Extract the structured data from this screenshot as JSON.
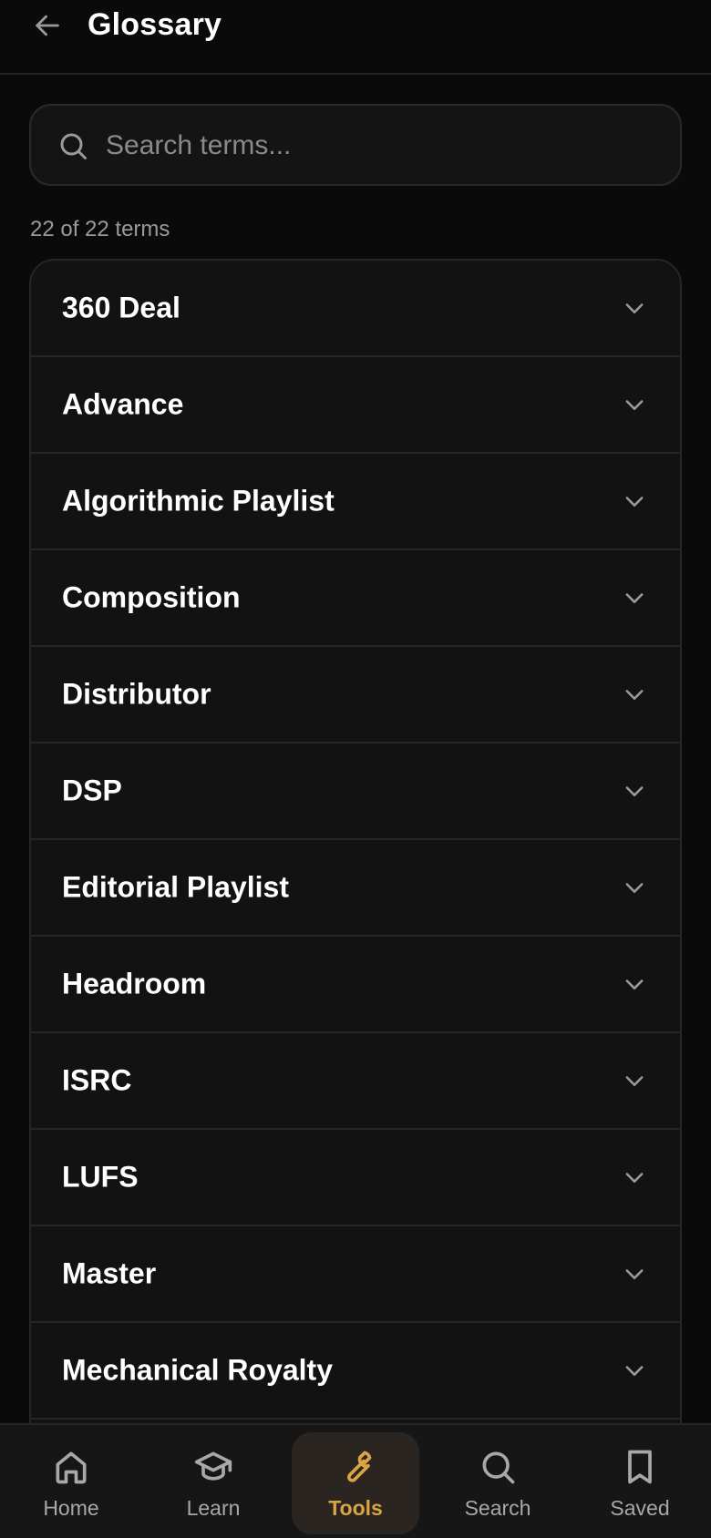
{
  "header": {
    "title": "Glossary",
    "back_icon": "arrow-left-icon"
  },
  "search": {
    "placeholder": "Search terms...",
    "value": ""
  },
  "count_text": "22 of 22 terms",
  "terms": [
    "360 Deal",
    "Advance",
    "Algorithmic Playlist",
    "Composition",
    "Distributor",
    "DSP",
    "Editorial Playlist",
    "Headroom",
    "ISRC",
    "LUFS",
    "Master",
    "Mechanical Royalty",
    ""
  ],
  "nav": {
    "items": [
      {
        "label": "Home",
        "icon": "home-icon",
        "active": false
      },
      {
        "label": "Learn",
        "icon": "graduation-cap-icon",
        "active": false
      },
      {
        "label": "Tools",
        "icon": "wrench-icon",
        "active": true
      },
      {
        "label": "Search",
        "icon": "search-icon",
        "active": false
      },
      {
        "label": "Saved",
        "icon": "bookmark-icon",
        "active": false
      }
    ]
  },
  "colors": {
    "background": "#0a0a0a",
    "surface": "#121212",
    "border": "#262626",
    "accent": "#d9a441",
    "text_muted": "#9a9a9a"
  }
}
